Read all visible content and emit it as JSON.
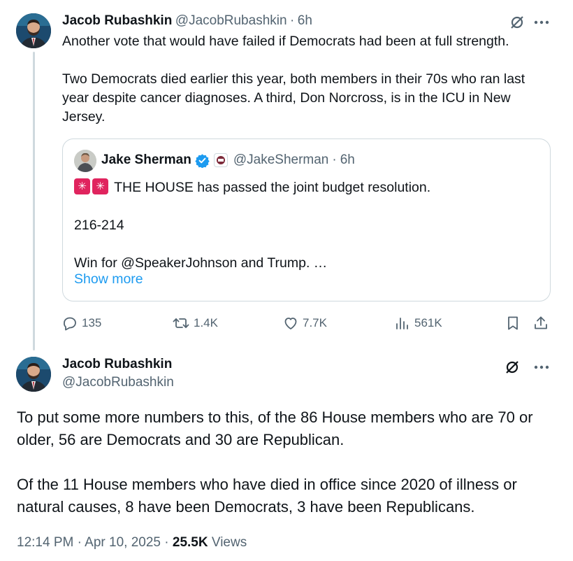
{
  "tweet1": {
    "name": "Jacob Rubashkin",
    "handle": "@JacobRubashkin",
    "sep": "·",
    "time": "6h",
    "paragraphs": [
      "Another vote that would have failed if Democrats had been at full strength.",
      "Two Democrats died earlier this year, both members in their 70s who ran last year despite cancer diagnoses. A third, Don Norcross, is in the ICU in New Jersey."
    ],
    "quote": {
      "name": "Jake Sherman",
      "handle": "@JakeSherman",
      "sep": "·",
      "time": "6h",
      "line1": "THE HOUSE has passed the joint budget resolution.",
      "line2": "216-214",
      "line3": "Win for @SpeakerJohnson and Trump. …",
      "show_more": "Show more"
    },
    "actions": {
      "replies": "135",
      "reposts": "1.4K",
      "likes": "7.7K",
      "views": "561K"
    }
  },
  "tweet2": {
    "name": "Jacob Rubashkin",
    "handle": "@JacobRubashkin",
    "paragraphs": [
      "To put some more numbers to this, of the 86 House members who are 70 or older, 56 are Democrats and 30 are Republican.",
      "Of the 11 House members who have died in office since 2020 of illness or natural causes, 8 have been Democrats, 3 have been Republicans."
    ],
    "time": "12:14 PM",
    "sep": "·",
    "date": "Apr 10, 2025",
    "sep2": "·",
    "views_count": "25.5K",
    "views_label": "Views"
  },
  "colors": {
    "text": "#0f1419",
    "muted": "#536471",
    "accent": "#1d9bf0",
    "border": "#cfd9de",
    "verified": "#1d9bf0",
    "siren": "#e0245e"
  },
  "icons": [
    "grok-icon",
    "more-icon",
    "verified-icon",
    "siren-icon",
    "reply-icon",
    "repost-icon",
    "like-icon",
    "views-icon",
    "bookmark-icon",
    "share-icon"
  ]
}
